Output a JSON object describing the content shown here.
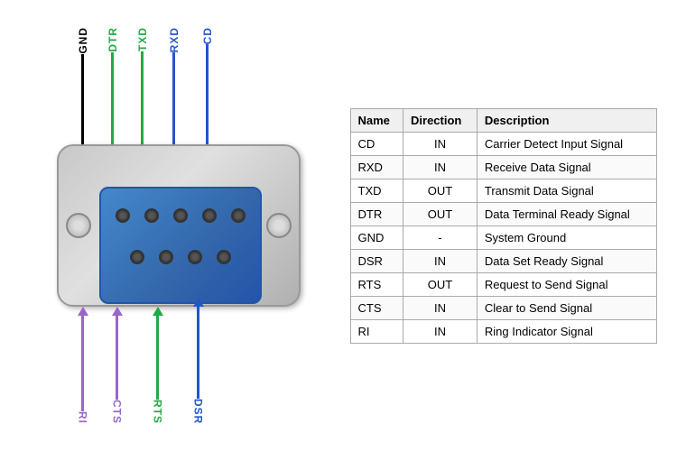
{
  "diagram": {
    "labels": {
      "GND": {
        "text": "GND",
        "color": "#000000"
      },
      "DTR": {
        "text": "DTR",
        "color": "#22aa44"
      },
      "TXD": {
        "text": "TXD",
        "color": "#22aa44"
      },
      "RXD": {
        "text": "RXD",
        "color": "#2255cc"
      },
      "CD": {
        "text": "CD",
        "color": "#2255cc"
      },
      "RI": {
        "text": "RI",
        "color": "#9966cc"
      },
      "CTS": {
        "text": "CTS",
        "color": "#9966cc"
      },
      "RTS": {
        "text": "RTS",
        "color": "#22aa44"
      },
      "DSR": {
        "text": "DSR",
        "color": "#2255cc"
      }
    },
    "top_pins": 5,
    "bottom_pins": 4
  },
  "table": {
    "headers": [
      "Name",
      "Direction",
      "Description"
    ],
    "rows": [
      {
        "name": "CD",
        "direction": "IN",
        "description": "Carrier Detect Input Signal"
      },
      {
        "name": "RXD",
        "direction": "IN",
        "description": "Receive Data Signal"
      },
      {
        "name": "TXD",
        "direction": "OUT",
        "description": "Transmit Data Signal"
      },
      {
        "name": "DTR",
        "direction": "OUT",
        "description": "Data Terminal Ready Signal"
      },
      {
        "name": "GND",
        "direction": "-",
        "description": "System Ground"
      },
      {
        "name": "DSR",
        "direction": "IN",
        "description": "Data Set Ready Signal"
      },
      {
        "name": "RTS",
        "direction": "OUT",
        "description": "Request to Send Signal"
      },
      {
        "name": "CTS",
        "direction": "IN",
        "description": "Clear to Send Signal"
      },
      {
        "name": "RI",
        "direction": "IN",
        "description": "Ring Indicator Signal"
      }
    ]
  }
}
